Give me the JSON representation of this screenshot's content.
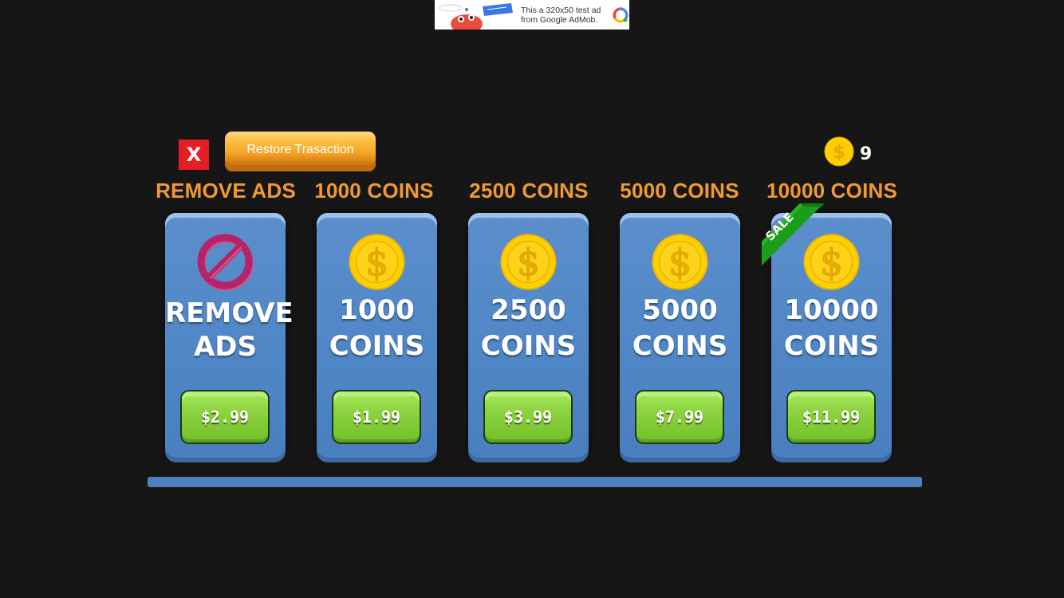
{
  "ad_banner": {
    "text_line1": "This a 320x50 test ad",
    "text_line2": "from Google AdMob."
  },
  "toolbar": {
    "close_label": "X",
    "restore_label": "Restore Trasaction",
    "coin_count": "9"
  },
  "products": [
    {
      "title": "REMOVE ADS",
      "label_line1": "REMOVE",
      "label_line2": "ADS",
      "price": "$2.99",
      "icon": "no-ads-icon",
      "sale": false
    },
    {
      "title": "1000 COINS",
      "label_line1": "1000",
      "label_line2": "COINS",
      "price": "$1.99",
      "icon": "coin-icon",
      "sale": false
    },
    {
      "title": "2500 COINS",
      "label_line1": "2500",
      "label_line2": "COINS",
      "price": "$3.99",
      "icon": "coin-icon",
      "sale": false
    },
    {
      "title": "5000 COINS",
      "label_line1": "5000",
      "label_line2": "COINS",
      "price": "$7.99",
      "icon": "coin-icon",
      "sale": false
    },
    {
      "title": "10000 COINS",
      "label_line1": "10000",
      "label_line2": "COINS",
      "price": "$11.99",
      "icon": "coin-icon",
      "sale": true
    }
  ],
  "sale_badge": "SALE",
  "colors": {
    "background": "#161616",
    "title_orange": "#f19a32",
    "card_blue": "#4f86c6",
    "price_green": "#8ed541",
    "close_red": "#e51e25",
    "coin_gold": "#fdd000",
    "sale_green": "#1a9e1a"
  }
}
